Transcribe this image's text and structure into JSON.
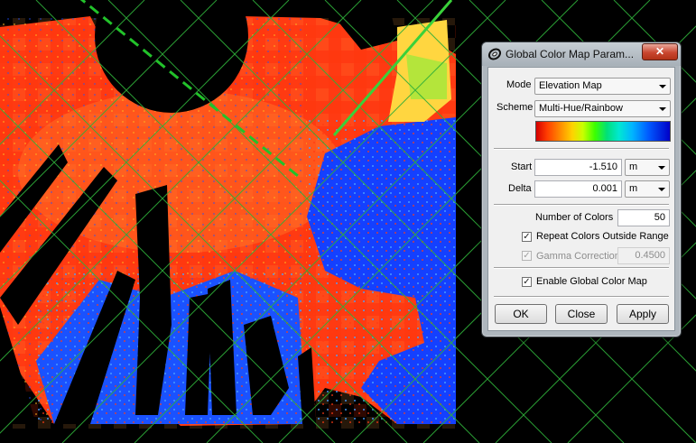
{
  "dialog": {
    "title": "Global Color Map Param...",
    "close_label": "✕",
    "mode_label": "Mode",
    "mode_value": "Elevation Map",
    "scheme_label": "Scheme",
    "scheme_value": "Multi-Hue/Rainbow",
    "start_label": "Start",
    "start_value": "-1.510",
    "start_unit": "m",
    "delta_label": "Delta",
    "delta_value": "0.001",
    "delta_unit": "m",
    "num_colors_label": "Number of Colors",
    "num_colors_value": "50",
    "repeat_label": "Repeat Colors Outside Range",
    "repeat_checked": true,
    "gamma_label": "Gamma Correction",
    "gamma_value": "0.4500",
    "gamma_checked": true,
    "enable_label": "Enable Global Color Map",
    "enable_checked": true,
    "ok_label": "OK",
    "close_button_label": "Close",
    "apply_label": "Apply"
  },
  "colors": {
    "grid": "#2fae3a",
    "axis_dashed": "#22c22a",
    "red": "#ff3a12",
    "orange": "#ff6a1c",
    "blue": "#1440ff",
    "yellow": "#ffe14a"
  }
}
